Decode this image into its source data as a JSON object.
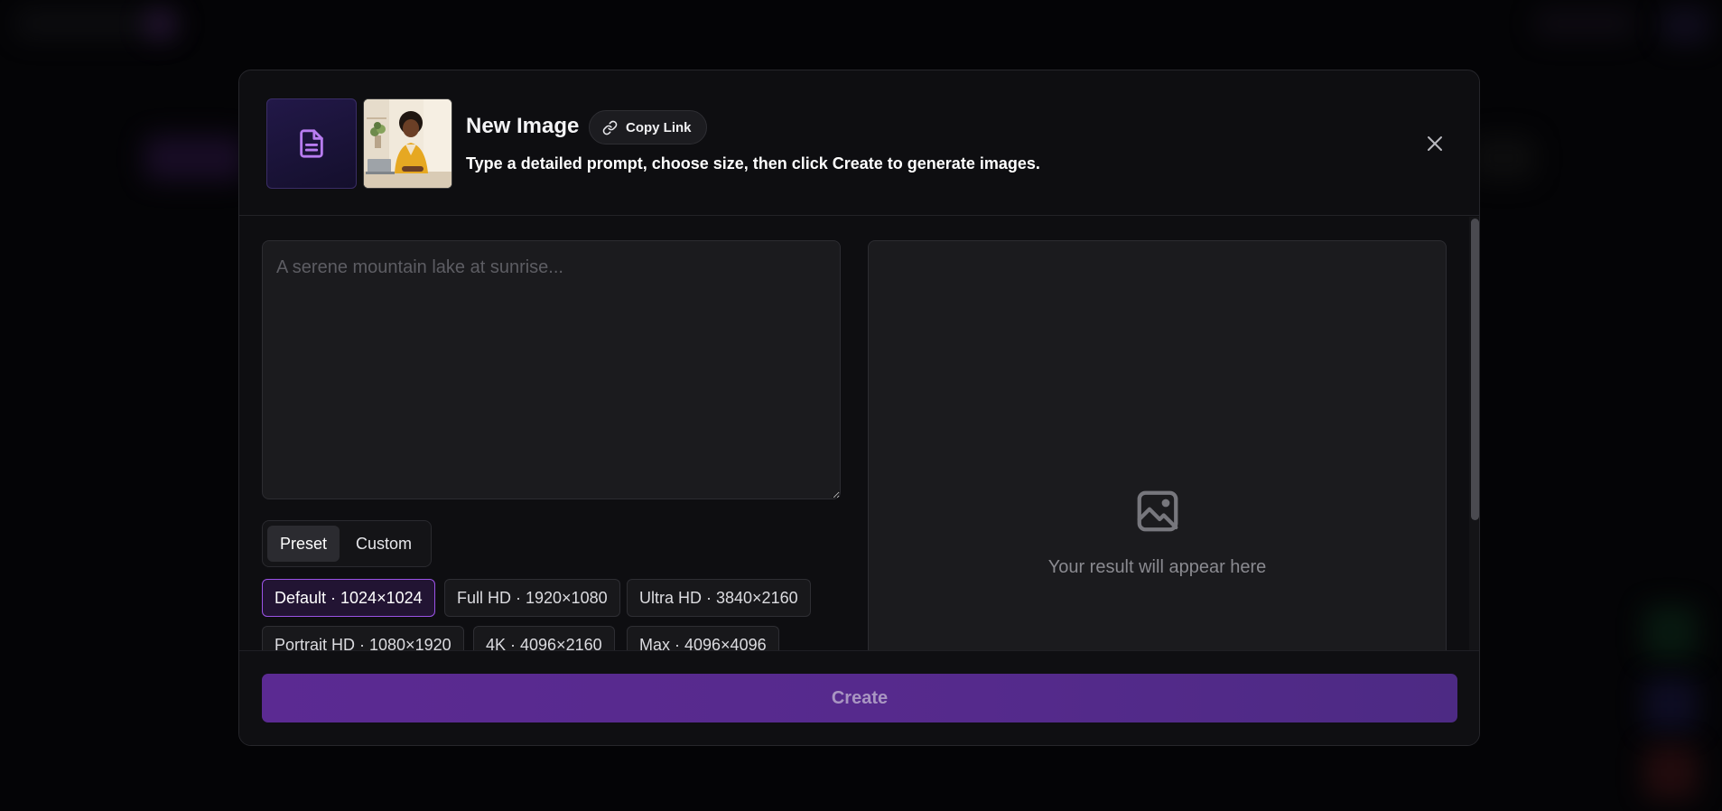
{
  "modal": {
    "title": "New Image",
    "copy_link_label": "Copy Link",
    "subtitle": "Type a detailed prompt, choose size, then click Create to generate images.",
    "close_icon": "close-icon",
    "thumbnails": [
      {
        "type": "document",
        "icon": "document-icon",
        "accent": "#b87cf0"
      },
      {
        "type": "photo",
        "description_icon": "photo-thumbnail"
      }
    ]
  },
  "prompt": {
    "value": "",
    "placeholder": "A serene mountain lake at sunrise..."
  },
  "size_mode": {
    "options": [
      "Preset",
      "Custom"
    ],
    "selected": "Preset"
  },
  "size_presets": [
    {
      "label": "Default · 1024×1024",
      "selected": true
    },
    {
      "label": "Full HD · 1920×1080",
      "selected": false
    },
    {
      "label": "Ultra HD · 3840×2160",
      "selected": false
    },
    {
      "label": "Portrait HD · 1080×1920",
      "selected": false
    },
    {
      "label": "4K · 4096×2160",
      "selected": false
    },
    {
      "label": "Max · 4096×4096",
      "selected": false
    }
  ],
  "result": {
    "placeholder_text": "Your result will appear here",
    "icon": "image-icon"
  },
  "footer": {
    "create_label": "Create"
  },
  "colors": {
    "accent": "#9b53e6",
    "create_button": "#5b2a92",
    "background": "#0e0e11"
  }
}
